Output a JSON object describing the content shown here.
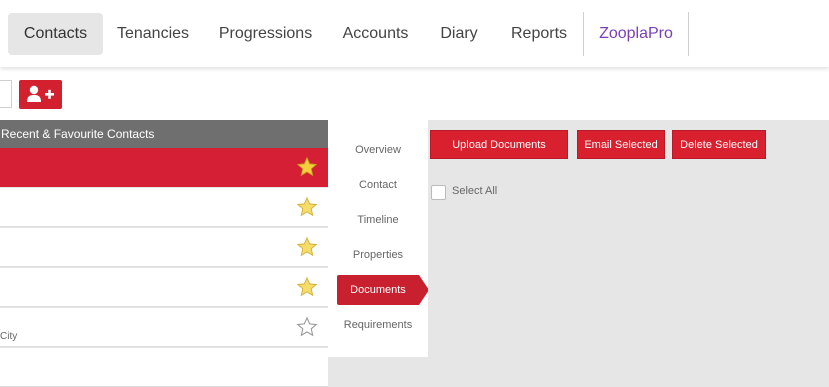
{
  "nav": {
    "items": [
      {
        "label": "Contacts"
      },
      {
        "label": "Tenancies"
      },
      {
        "label": "Progressions"
      },
      {
        "label": "Accounts"
      },
      {
        "label": "Diary"
      },
      {
        "label": "Reports"
      },
      {
        "label": "ZooplaPro"
      }
    ]
  },
  "contacts": {
    "header": "Recent & Favourite Contacts",
    "rows": [
      {
        "sub": "",
        "favourite": true,
        "selected": true
      },
      {
        "sub": "",
        "favourite": true
      },
      {
        "sub": "",
        "favourite": true
      },
      {
        "sub": "",
        "favourite": true
      },
      {
        "sub": "City",
        "favourite": false
      }
    ]
  },
  "subnav": {
    "items": [
      {
        "label": "Overview"
      },
      {
        "label": "Contact"
      },
      {
        "label": "Timeline"
      },
      {
        "label": "Properties"
      },
      {
        "label": "Documents"
      },
      {
        "label": "Requirements"
      }
    ]
  },
  "documents": {
    "upload_label": "Upload Documents",
    "email_label": "Email Selected",
    "delete_label": "Delete Selected",
    "select_all_label": "Select All"
  },
  "colors": {
    "accent": "#d3202f",
    "brand_purple": "#7a3fb6",
    "star_gold": "#f4d03f"
  }
}
